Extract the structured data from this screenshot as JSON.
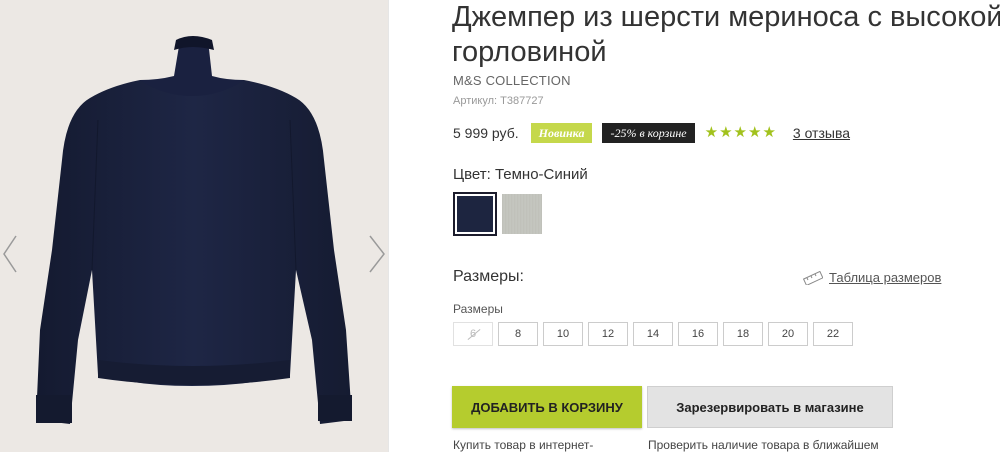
{
  "product": {
    "title": "Джемпер из шерсти мериноса с высокой горловиной",
    "brand": "M&S COLLECTION",
    "sku_label": "Артикул:",
    "sku_value": "T387727",
    "price": "5 999 руб.",
    "badge_new": "Новинка",
    "badge_sale": "-25% в корзине",
    "rating": 5,
    "reviews_label": "3 отзыва",
    "star_color": "#a2c21d",
    "accent_color": "#b5cc2e"
  },
  "color": {
    "label": "Цвет: Темно-Синий",
    "swatches": [
      {
        "name": "navy",
        "hex": "#1d2540",
        "selected": true
      },
      {
        "name": "grey",
        "hex": "#c3c4be",
        "selected": false
      }
    ]
  },
  "sizes": {
    "heading": "Размеры:",
    "guide_label": "Таблица размеров",
    "sublabel": "Размеры",
    "options": [
      {
        "label": "6",
        "available": false
      },
      {
        "label": "8",
        "available": true
      },
      {
        "label": "10",
        "available": true
      },
      {
        "label": "12",
        "available": true
      },
      {
        "label": "14",
        "available": true
      },
      {
        "label": "16",
        "available": true
      },
      {
        "label": "18",
        "available": true
      },
      {
        "label": "20",
        "available": true
      },
      {
        "label": "22",
        "available": true
      }
    ]
  },
  "actions": {
    "add_to_cart": "ДОБАВИТЬ В КОРЗИНУ",
    "reserve": "Зарезервировать в магазине",
    "note_left": "Купить товар в интернет-",
    "note_right": "Проверить наличие товара в ближайшем"
  },
  "gallery": {
    "prev_icon": "chevron-left-icon",
    "next_icon": "chevron-right-icon"
  }
}
